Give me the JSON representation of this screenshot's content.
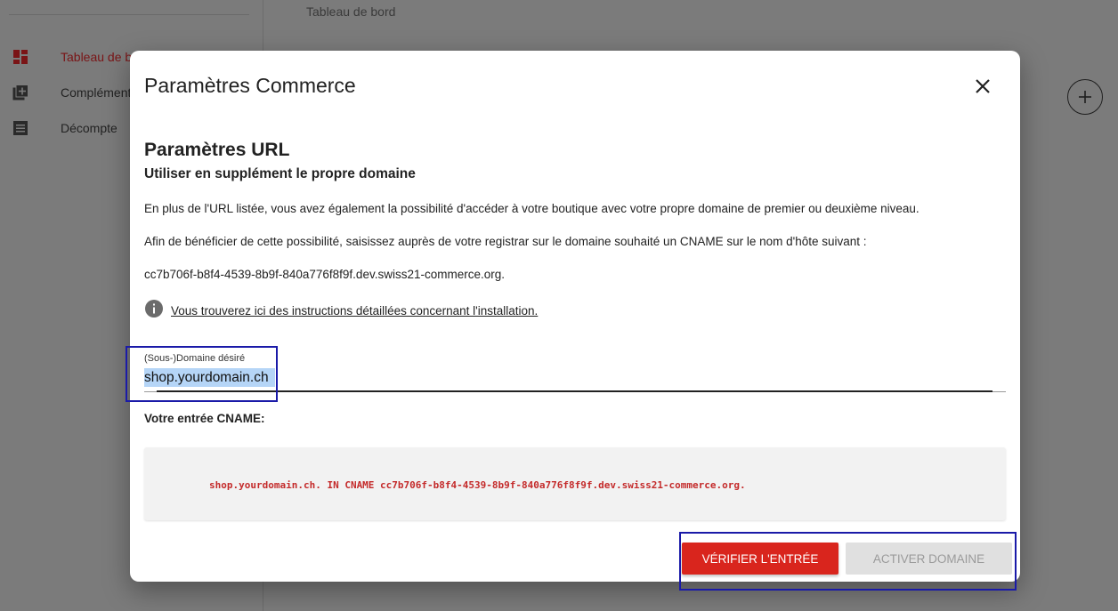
{
  "sidebar": {
    "items": [
      {
        "label": "Tableau de bord",
        "icon": "dashboard-icon",
        "active": true
      },
      {
        "label": "Compléments",
        "icon": "library-add-icon"
      },
      {
        "label": "Décompte",
        "icon": "list-icon"
      }
    ]
  },
  "main": {
    "breadcrumb": "Tableau de bord"
  },
  "modal": {
    "title": "Paramètres Commerce",
    "section_title": "Paramètres URL",
    "section_subtitle": "Utiliser en supplément le propre domaine",
    "paragraph_1": "En plus de l'URL listée, vous avez également la possibilité d'accéder à votre boutique avec votre propre domaine de premier ou deuxième niveau.",
    "paragraph_2": "Afin de bénéficier de cette possibilité, saisissez auprès de votre registrar sur le domaine souhaité un CNAME sur le nom d'hôte suivant :",
    "hostname": "cc7b706f-b8f4-4539-8b9f-840a776f8f9f.dev.swiss21-commerce.org.",
    "instructions_link": "Vous trouverez ici des instructions détaillées concernant l'installation.",
    "domain_field": {
      "label": "(Sous-)Domaine désiré",
      "value": "shop.yourdomain.ch"
    },
    "cname_label": "Votre entrée CNAME:",
    "cname_entry": "shop.yourdomain.ch. IN CNAME cc7b706f-b8f4-4539-8b9f-840a776f8f9f.dev.swiss21-commerce.org.",
    "verify_button": "VÉRIFIER L'ENTRÉE",
    "activate_button": "ACTIVER DOMAINE"
  },
  "colors": {
    "accent": "#d9251d",
    "code_text": "#c42a2a",
    "overlay": "#7b7b7b"
  }
}
